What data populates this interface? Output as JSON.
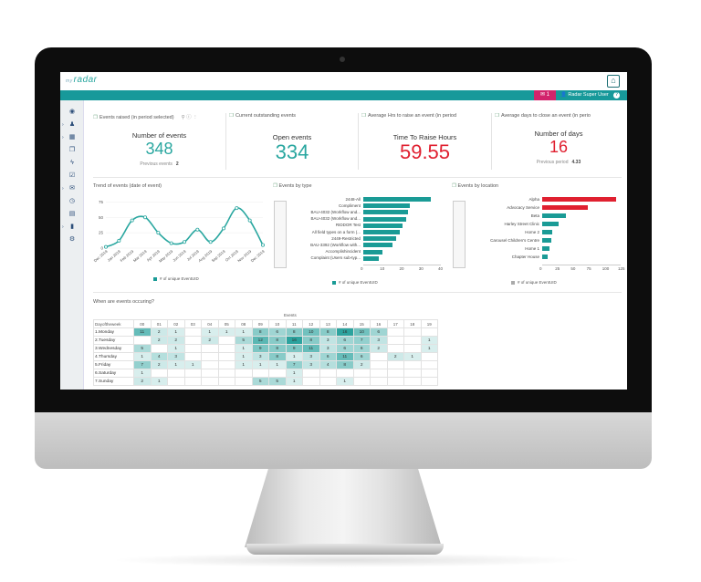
{
  "app": {
    "logo_prefix": "my",
    "logo_text": "radar",
    "user_label": "Radar Super User",
    "notifications": "1",
    "help": "?"
  },
  "kpis": [
    {
      "title": "Events raised (in period selected)",
      "caption": "Number of events",
      "value": "348",
      "prev_label": "Previous events",
      "prev_value": "2",
      "color": "#2aa7a0"
    },
    {
      "title": "Current outstanding events",
      "caption": "Open events",
      "value": "334",
      "color": "#2aa7a0"
    },
    {
      "title": "Average Hrs to raise an event (in period",
      "caption": "Time To Raise Hours",
      "value": "59.55",
      "color": "#e02030"
    },
    {
      "title": "Average days to close an event (in perio",
      "caption": "Number of days",
      "value": "16",
      "prev_label": "Previous period",
      "prev_value": "4.33",
      "color": "#e02030"
    }
  ],
  "trend": {
    "title": "Trend of events (date of event)",
    "legend": "# of unique EventUID",
    "chart_data": {
      "type": "line",
      "x": [
        "Dec 2018",
        "Jan 2019",
        "Feb 2019",
        "Mar 2019",
        "Apr 2019",
        "May 2019",
        "Jun 2019",
        "Jul 2019",
        "Aug 2019",
        "Sep 2019",
        "Oct 2019",
        "Nov 2019",
        "Dec 2019"
      ],
      "values": [
        2,
        12,
        45,
        50,
        25,
        8,
        10,
        30,
        10,
        32,
        65,
        45,
        5
      ],
      "yticks": [
        0,
        25,
        50,
        75
      ],
      "ylim": [
        0,
        80
      ],
      "color": "#2aa7a0"
    }
  },
  "types": {
    "title": "Events by type",
    "legend": "# of unique EventUID",
    "chart_data": {
      "type": "bar",
      "categories": [
        "2448-All",
        "Compliment",
        "BAU-4032 (Workflow and...",
        "BAU-4032 (Workflow and...",
        "RIDDOR Test",
        "All field types on a form (...",
        "2449-Restricted",
        "BAU-3392 (Workflow with...",
        "Accomplishincident",
        "Complaint (Users sub-typ..."
      ],
      "values": [
        35,
        24,
        23,
        22,
        20,
        19,
        17,
        15,
        10,
        8
      ],
      "xticks": [
        0,
        10,
        20,
        30,
        40
      ],
      "xlim": [
        0,
        40
      ],
      "color": "#1a9b96"
    }
  },
  "locations": {
    "title": "Events by location",
    "legend": "# of unique EventUID",
    "chart_data": {
      "type": "bar",
      "categories": [
        "Alpha",
        "Advocacy Service",
        "Beta",
        "Harley Street Clinic",
        "Home 2",
        "Carousel Children's Centre",
        "Home 1",
        "Chapter House"
      ],
      "values": [
        118,
        72,
        38,
        26,
        16,
        14,
        12,
        9
      ],
      "colors": [
        "#e02030",
        "#e02030",
        "#1a9b96",
        "#1a9b96",
        "#1a9b96",
        "#1a9b96",
        "#1a9b96",
        "#1a9b96"
      ],
      "xticks": [
        0,
        25,
        50,
        75,
        100,
        125
      ],
      "xlim": [
        0,
        125
      ]
    }
  },
  "heatmap": {
    "title": "When are events occuring?",
    "group_header": "Events",
    "row_header": "Dayoftheweek",
    "hours": [
      "00",
      "01",
      "02",
      "03",
      "04",
      "05",
      "08",
      "09",
      "10",
      "11",
      "12",
      "13",
      "14",
      "15",
      "16",
      "17",
      "18",
      "19"
    ],
    "rows": [
      {
        "label": "1.Monday",
        "cells": [
          "11",
          "2",
          "1",
          "",
          "1",
          "1",
          "1",
          "8",
          "6",
          "8",
          "10",
          "8",
          "16",
          "10",
          "6",
          "",
          "",
          ""
        ]
      },
      {
        "label": "2.Tuesday",
        "cells": [
          "",
          "2",
          "2",
          "",
          "2",
          "",
          "5",
          "12",
          "8",
          "16",
          "8",
          "3",
          "6",
          "7",
          "3",
          "",
          "",
          "1"
        ]
      },
      {
        "label": "3.Wednesday",
        "cells": [
          "5",
          "",
          "1",
          "",
          "",
          "",
          "1",
          "9",
          "8",
          "9",
          "11",
          "3",
          "6",
          "6",
          "2",
          "",
          "",
          "1"
        ]
      },
      {
        "label": "4.Thursday",
        "cells": [
          "1",
          "4",
          "3",
          "",
          "",
          "",
          "1",
          "3",
          "8",
          "1",
          "3",
          "6",
          "11",
          "6",
          "",
          "2",
          "1",
          ""
        ]
      },
      {
        "label": "5.Friday",
        "cells": [
          "7",
          "2",
          "1",
          "1",
          "",
          "",
          "1",
          "1",
          "1",
          "7",
          "3",
          "4",
          "8",
          "2",
          "",
          "",
          "",
          ""
        ]
      },
      {
        "label": "6.Saturday",
        "cells": [
          "1",
          "",
          "",
          "",
          "",
          "",
          "",
          "",
          "",
          "1",
          "",
          "",
          "",
          "",
          "",
          "",
          "",
          ""
        ]
      },
      {
        "label": "7.Sunday",
        "cells": [
          "2",
          "1",
          "",
          "",
          "",
          "",
          "",
          "5",
          "5",
          "1",
          "",
          "",
          "1",
          "",
          "",
          "",
          "",
          ""
        ]
      }
    ]
  }
}
